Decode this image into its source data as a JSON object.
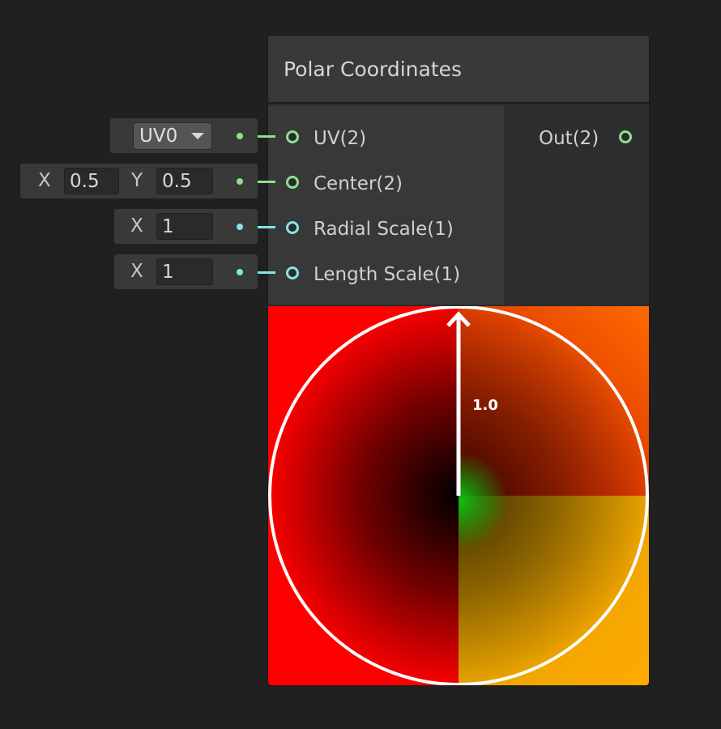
{
  "node": {
    "title": "Polar Coordinates",
    "inputs": [
      {
        "label": "UV(2)",
        "type": "vector2"
      },
      {
        "label": "Center(2)",
        "type": "vector2"
      },
      {
        "label": "Radial Scale(1)",
        "type": "float"
      },
      {
        "label": "Length Scale(1)",
        "type": "float"
      }
    ],
    "output": {
      "label": "Out(2)"
    }
  },
  "fields": {
    "uv": {
      "value": "UV0"
    },
    "center": {
      "x_label": "X",
      "x_value": "0.5",
      "y_label": "Y",
      "y_value": "0.5"
    },
    "radial_scale": {
      "x_label": "X",
      "x_value": "1"
    },
    "length_scale": {
      "x_label": "X",
      "x_value": "1"
    }
  },
  "preview": {
    "radius_label": "1.0"
  },
  "colors": {
    "vector2_port": "#8ee08e",
    "float_port": "#84e4e7",
    "background": "#202020"
  }
}
